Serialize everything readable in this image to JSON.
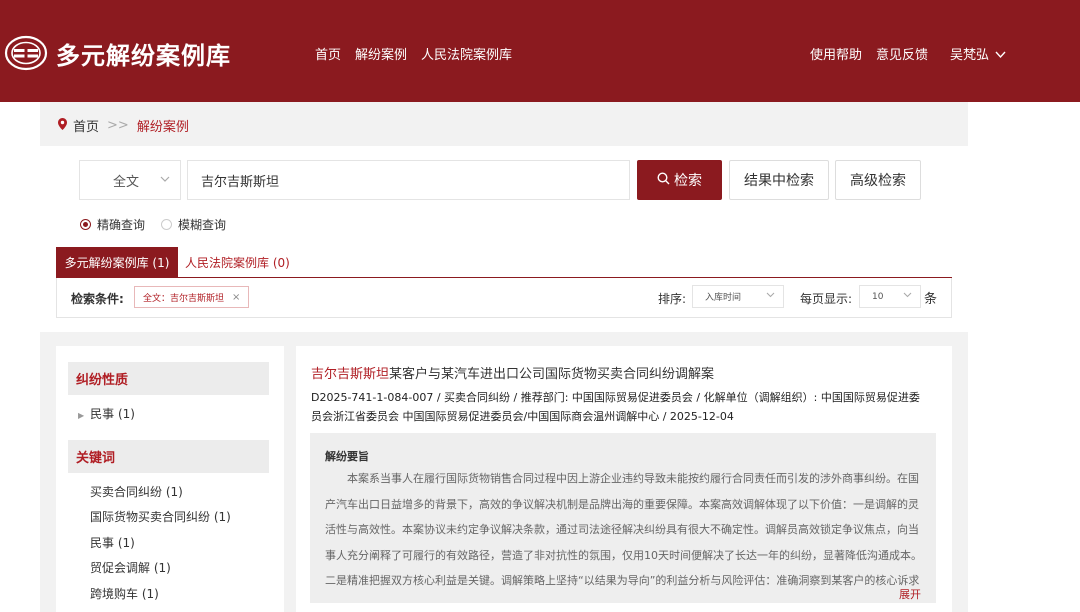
{
  "header": {
    "brand": "多元解纷案例库",
    "nav": [
      "首页",
      "解纷案例",
      "人民法院案例库"
    ],
    "links": [
      "使用帮助",
      "意见反馈"
    ],
    "user": "吴梵弘",
    "user_icon": "chevron-down-icon",
    "colors": {
      "primary": "#8b1a1f",
      "accent": "#b01e24"
    }
  },
  "breadcrumb": {
    "home": "首页",
    "sep": ">>",
    "current": "解纷案例"
  },
  "search": {
    "scope": "全文",
    "query": "吉尔吉斯斯坦",
    "search_button": "检索",
    "within_button": "结果中检索",
    "advanced_button": "高级检索",
    "modes": [
      {
        "label": "精确查询",
        "selected": true
      },
      {
        "label": "模糊查询",
        "selected": false
      }
    ]
  },
  "tabs": {
    "active": "多元解纷案例库 (1)",
    "other": "人民法院案例库 (0)"
  },
  "conditions": {
    "label": "检索条件:",
    "tag": "全文：吉尔吉斯斯坦",
    "sort_label": "排序:",
    "sort_value": "入库时间",
    "per_page_label": "每页显示:",
    "per_page_value": "10",
    "per_page_unit": "条"
  },
  "facets": {
    "nature": {
      "title": "纠纷性质",
      "items": [
        "民事  (1)"
      ]
    },
    "keywords": {
      "title": "关键词",
      "items": [
        "买卖合同纠纷  (1)",
        "国际货物买卖合同纠纷  (1)",
        "民事  (1)",
        "贸促会调解  (1)",
        "跨境购车  (1)"
      ]
    }
  },
  "result": {
    "title_highlight": "吉尔吉斯斯坦",
    "title_rest": "某客户与某汽车进出口公司国际货物买卖合同纠纷调解案",
    "meta_line1": "D2025-741-1-084-007 / 买卖合同纠纷 / 推荐部门:  中国国际贸易促进委员会   / 化解单位（调解组织）:  中国国际贸易促进委",
    "meta_line2": "员会浙江省委员会  中国国际贸易促进委员会/中国国际商会温州调解中心  / 2025-12-04",
    "summary_title": "解纷要旨",
    "summary_body": "本案系当事人在履行国际货物销售合同过程中因上游企业违约导致未能按约履行合同责任而引发的涉外商事纠纷。在国产汽车出口日益增多的背景下，高效的争议解决机制是品牌出海的重要保障。本案高效调解体现了以下价值：一是调解的灵活性与高效性。本案协议未约定争议解决条款，通过司法途径解决纠纷具有很大不确定性。调解员高效锁定争议焦点，向当事人充分阐释了可履行的有效路径，营造了非对抗性的氛围，仅用10天时间便解决了长达一年的纠纷，显著降低沟通成本。二是精准把握双方核心利益是关键。调解策略上坚持“以结果为导向”的利益分析与风险评估：准确洞察到某客户的核心诉求是“...",
    "expand": "展开"
  }
}
